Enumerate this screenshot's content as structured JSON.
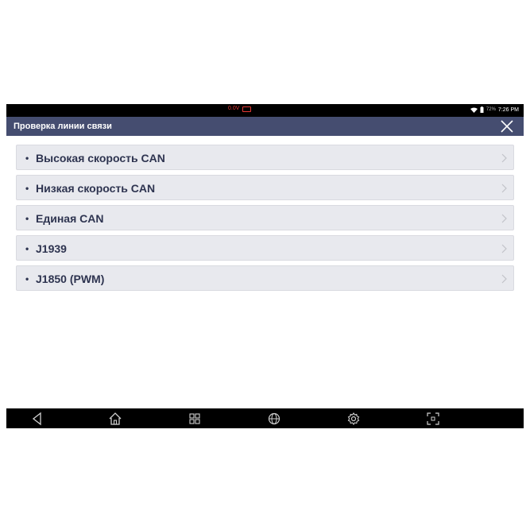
{
  "status": {
    "voltage": "0.0V",
    "battery_pct": "72%",
    "time": "7:26 PM"
  },
  "header": {
    "title": "Проверка линии связи"
  },
  "list": {
    "items": [
      {
        "label": "Высокая скорость CAN"
      },
      {
        "label": "Низкая скорость CAN"
      },
      {
        "label": "Единая CAN"
      },
      {
        "label": "J1939"
      },
      {
        "label": "J1850 (PWM)"
      }
    ]
  },
  "colors": {
    "header_bg": "#454d70",
    "item_bg": "#e8e9ee",
    "item_text": "#2e3450",
    "voltage_warning": "#e53935"
  },
  "navbar": {
    "icons": [
      "back-icon",
      "home-icon",
      "apps-icon",
      "globe-icon",
      "settings-icon",
      "screenshot-icon"
    ]
  }
}
